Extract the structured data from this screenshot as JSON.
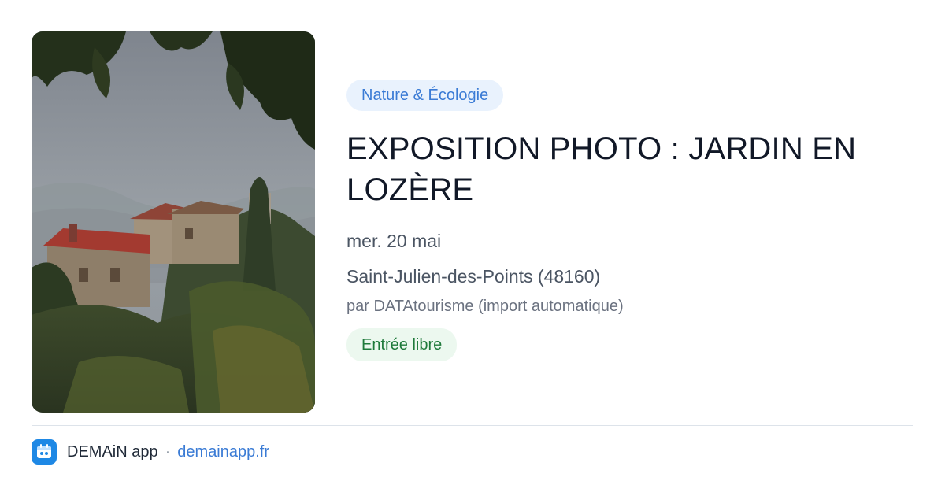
{
  "event": {
    "category": "Nature & Écologie",
    "title": "EXPOSITION PHOTO : JARDIN EN LOZÈRE",
    "date": "mer. 20 mai",
    "location": "Saint-Julien-des-Points (48160)",
    "organizer": "par DATAtourisme (import automatique)",
    "price": "Entrée libre",
    "image_icon": "village-photo"
  },
  "footer": {
    "app_name": "DEMAiN app",
    "separator": "·",
    "site": "demainapp.fr",
    "logo_icon": "demain-app-icon"
  },
  "colors": {
    "category_bg": "#e9f2fd",
    "category_text": "#3a7bd5",
    "price_bg": "#ecf8ef",
    "price_text": "#1f7a3b",
    "link": "#3a7bd5",
    "logo": "#1e88e5"
  }
}
